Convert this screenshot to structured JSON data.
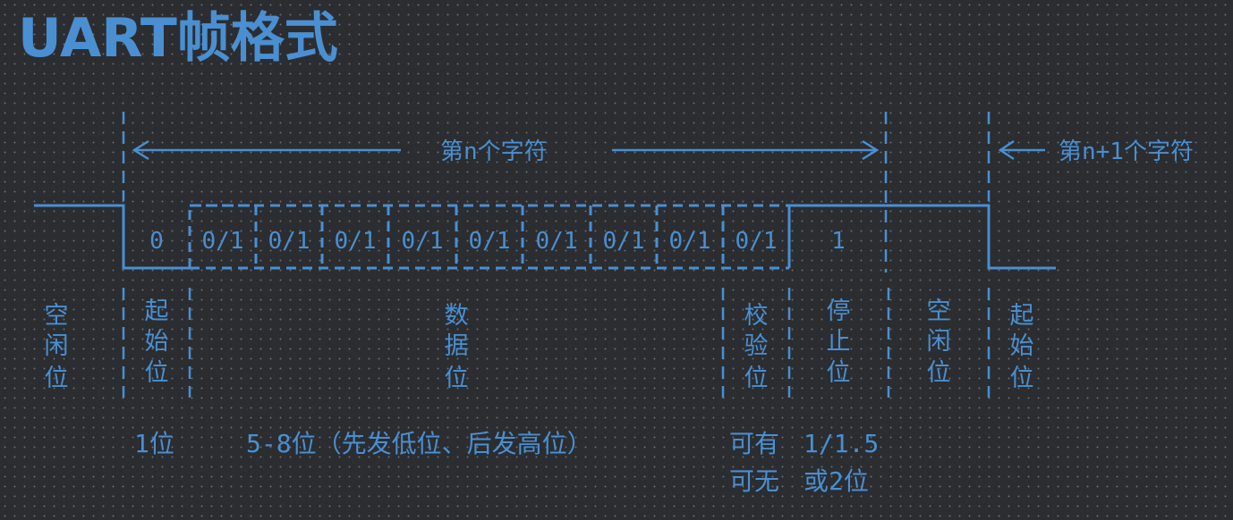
{
  "title": "UART帧格式",
  "header": {
    "char_n": "第n个字符",
    "char_n1": "第n+1个字符"
  },
  "bits": {
    "start": "0",
    "data": [
      "0/1",
      "0/1",
      "0/1",
      "0/1",
      "0/1",
      "0/1",
      "0/1",
      "0/1"
    ],
    "parity": "0/1",
    "stop": "1"
  },
  "fields": {
    "idle_left": [
      "空",
      "闲",
      "位"
    ],
    "start": [
      "起",
      "始",
      "位"
    ],
    "data": [
      "数",
      "据",
      "位"
    ],
    "parity": [
      "校",
      "验",
      "位"
    ],
    "stop": [
      "停",
      "止",
      "位"
    ],
    "idle_right": [
      "空",
      "闲",
      "位"
    ],
    "next_start": [
      "起",
      "始",
      "位"
    ]
  },
  "notes": {
    "start_len": "1位",
    "data_len": "5-8位（先发低位、后发高位）",
    "parity_line1": "可有",
    "parity_line2": "可无",
    "stop_line1": "1/1.5",
    "stop_line2": "或2位"
  },
  "colors": {
    "background": "#2b2d31",
    "accent": "#4a8fd1"
  }
}
